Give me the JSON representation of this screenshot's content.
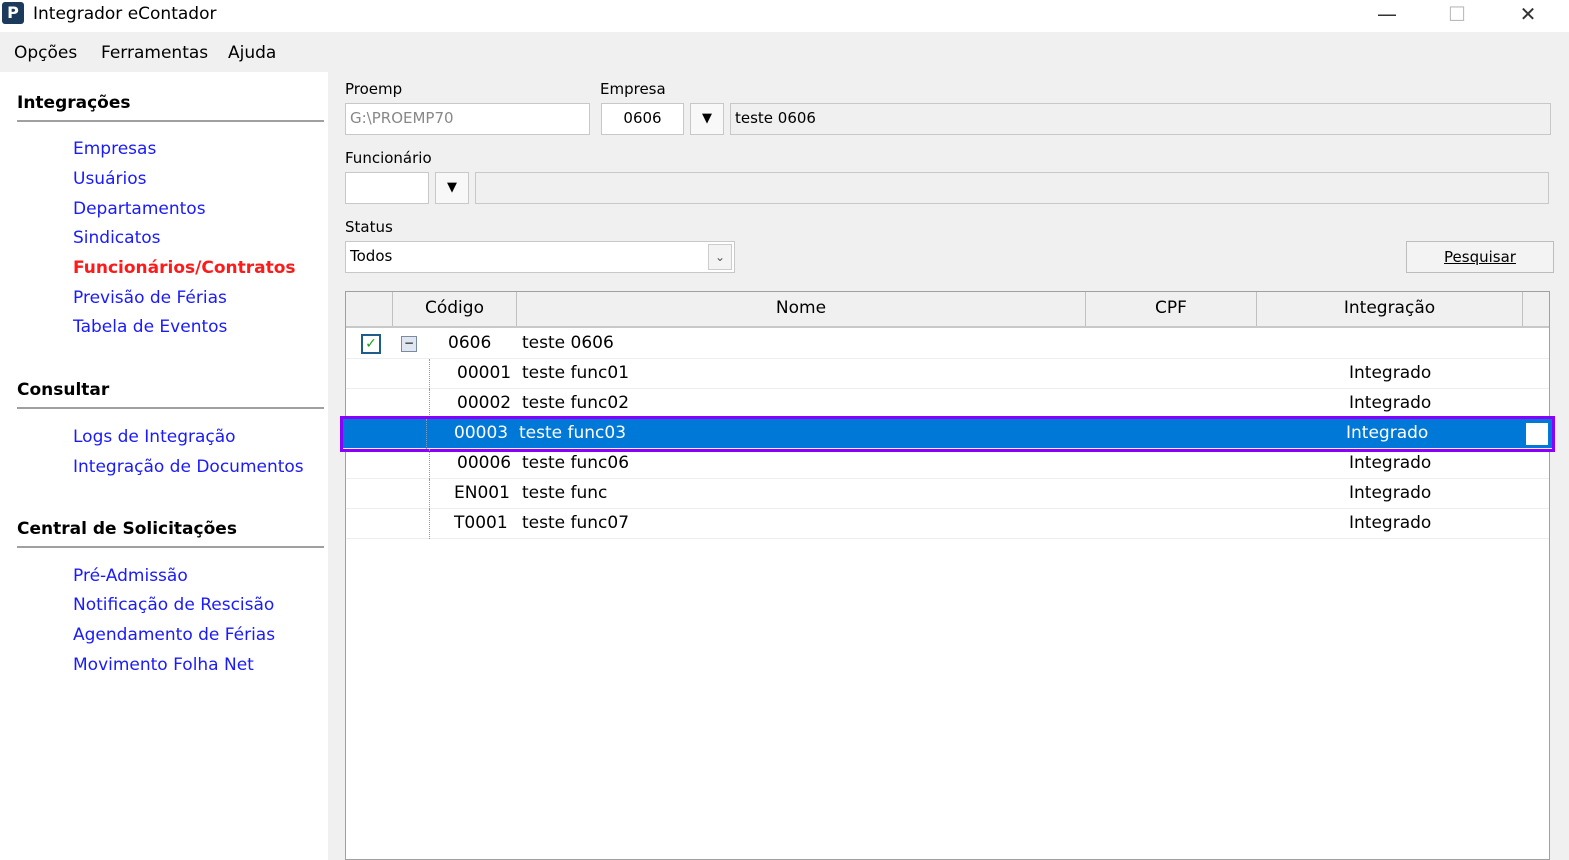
{
  "window": {
    "title": "Integrador eContador",
    "logo": "P"
  },
  "menu": [
    "Opções",
    "Ferramentas",
    "Ajuda"
  ],
  "sidebar": {
    "sections": [
      {
        "title": "Integrações",
        "items": [
          "Empresas",
          "Usuários",
          "Departamentos",
          "Sindicatos",
          "Funcionários/Contratos",
          "Previsão de Férias",
          "Tabela de Eventos"
        ]
      },
      {
        "title": "Consultar",
        "items": [
          "Logs de Integração",
          "Integração de Documentos"
        ]
      },
      {
        "title": "Central de Solicitações",
        "items": [
          "Pré-Admissão",
          "Notificação de Rescisão",
          "Agendamento de Férias",
          "Movimento Folha Net"
        ]
      }
    ],
    "active": "Funcionários/Contratos"
  },
  "form": {
    "proemp_label": "Proemp",
    "proemp_value": "G:\\PROEMP70",
    "empresa_label": "Empresa",
    "empresa_code": "0606",
    "empresa_name": "teste 0606",
    "funcionario_label": "Funcionário",
    "funcionario_code": "",
    "funcionario_name": "",
    "status_label": "Status",
    "status_value": "Todos",
    "search_button": "Pesquisar"
  },
  "grid": {
    "columns": [
      "",
      "Código",
      "Nome",
      "CPF",
      "Integração"
    ],
    "parent": {
      "checked": true,
      "code": "0606",
      "name": "teste 0606"
    },
    "rows": [
      {
        "code": "00001",
        "name": "teste func01",
        "cpf": "",
        "status": "Integrado"
      },
      {
        "code": "00002",
        "name": "teste func02",
        "cpf": "",
        "status": "Integrado"
      },
      {
        "code": "00003",
        "name": "teste func03",
        "cpf": "",
        "status": "Integrado",
        "selected": true
      },
      {
        "code": "00006",
        "name": "teste func06",
        "cpf": "",
        "status": "Integrado"
      },
      {
        "code": "EN001",
        "name": "teste func",
        "cpf": "",
        "status": "Integrado"
      },
      {
        "code": "T0001",
        "name": "teste func07",
        "cpf": "",
        "status": "Integrado"
      }
    ]
  }
}
